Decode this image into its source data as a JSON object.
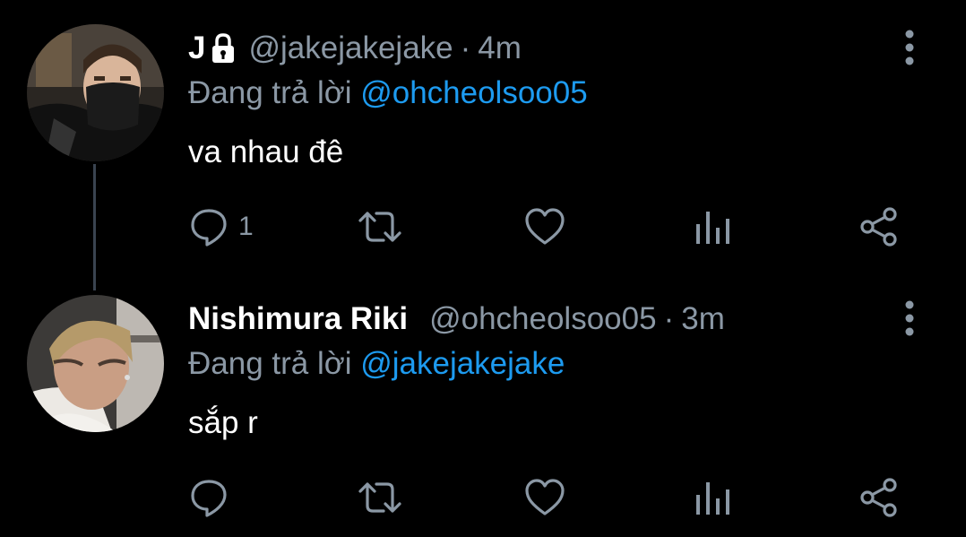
{
  "colors": {
    "background": "#000000",
    "primary_text": "#ffffff",
    "secondary_text": "#8b98a5",
    "mention": "#1d9bf0",
    "thread_line": "#3a4450"
  },
  "tweets": [
    {
      "name": "J",
      "locked": true,
      "handle": "@jakejakejake",
      "separator": "·",
      "time": "4m",
      "reply_prefix": "Đang trả lời",
      "reply_to": "@ohcheolsoo05",
      "text": "va nhau đê",
      "actions": {
        "reply_count": "1",
        "retweet_count": "",
        "like_count": ""
      },
      "avatar_icon": "avatar-masked-user",
      "more_icon": "vertical-ellipsis-icon"
    },
    {
      "name": "Nishimura Riki",
      "locked": false,
      "handle": "@ohcheolsoo05",
      "separator": "·",
      "time": "3m",
      "reply_prefix": "Đang trả lời",
      "reply_to": "@jakejakejake",
      "text": "sắp r",
      "actions": {
        "reply_count": "",
        "retweet_count": "",
        "like_count": ""
      },
      "avatar_icon": "avatar-user",
      "more_icon": "vertical-ellipsis-icon"
    }
  ]
}
